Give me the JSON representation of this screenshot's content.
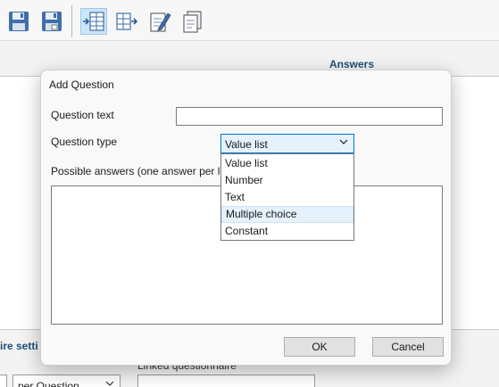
{
  "toolbar": {
    "buttons": [
      {
        "icon": "save-icon"
      },
      {
        "icon": "save-as-icon"
      },
      {
        "icon": "insert-row-icon",
        "active": true
      },
      {
        "icon": "insert-column-icon"
      },
      {
        "icon": "edit-document-icon"
      },
      {
        "icon": "copy-document-icon"
      }
    ]
  },
  "background": {
    "answers_header": "Answers",
    "settings_label": "ire setti",
    "linked_questionnaire_label": "Linked questionnaire",
    "scope_select_value": "per Question"
  },
  "dialog": {
    "title": "Add Question",
    "question_text_label": "Question text",
    "question_text_value": "",
    "question_type_label": "Question type",
    "question_type_value": "Value list",
    "possible_answers_label": "Possible answers (one answer per lin",
    "possible_answers_value": "",
    "question_type_options": [
      "Value list",
      "Number",
      "Text",
      "Multiple choice",
      "Constant"
    ],
    "highlighted_option": "Multiple choice",
    "ok_label": "OK",
    "cancel_label": "Cancel"
  },
  "colors": {
    "accent": "#0078d4",
    "header_text": "#1f4e79",
    "highlight": "#e5f1fb"
  }
}
